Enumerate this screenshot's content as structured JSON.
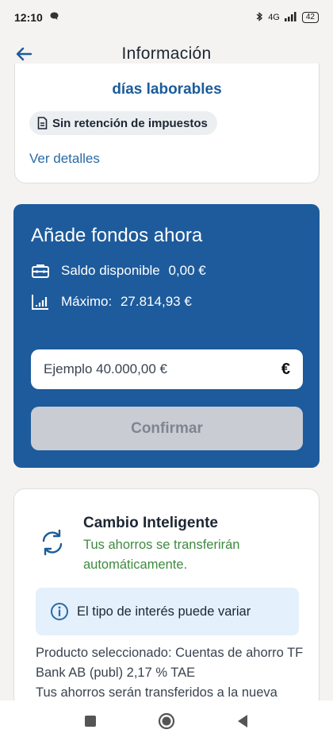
{
  "status_bar": {
    "time": "12:10",
    "network": "4G",
    "battery": "42"
  },
  "app_bar": {
    "title": "Información"
  },
  "summary_card": {
    "days_text": "días laborables",
    "tax_chip": "Sin retención de impuestos",
    "details_link": "Ver detalles"
  },
  "funds": {
    "title": "Añade fondos ahora",
    "balance_label": "Saldo disponible",
    "balance_value": "0,00 €",
    "max_label": "Máximo:",
    "max_value": "27.814,93 €",
    "amount_placeholder": "Ejemplo 40.000,00 €",
    "currency_symbol": "€",
    "confirm_label": "Confirmar"
  },
  "smart_change": {
    "title": "Cambio Inteligente",
    "subtitle": "Tus ahorros se transferirán automáticamente.",
    "rate_notice": "El tipo de interés puede variar",
    "product_text_1": "Producto seleccionado:  Cuentas de ahorro TF Bank AB (publ) 2,17 % TAE",
    "product_text_2": "Tus ahorros serán transferidos a la nueva"
  },
  "colors": {
    "brand_blue": "#1d5b9c",
    "link_blue": "#2a6aa6",
    "success_green": "#3f8a3f",
    "info_bg": "#e4f0fb",
    "disabled_button": "#c9ccd2"
  },
  "icons": {
    "back": "arrow-left-icon",
    "document": "document-icon",
    "briefcase": "briefcase-icon",
    "chart": "chart-icon",
    "sync": "sync-icon",
    "info": "info-icon",
    "nav_recents": "square-icon",
    "nav_home": "circle-icon",
    "nav_back": "triangle-back-icon"
  }
}
